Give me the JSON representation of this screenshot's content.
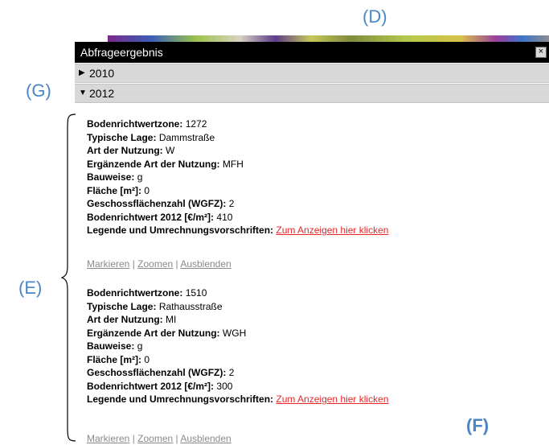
{
  "annotations": {
    "d": "(D)",
    "g": "(G)",
    "e": "(E)",
    "f": "(F)"
  },
  "window": {
    "title": "Abfrageergebnis",
    "close_label": "×"
  },
  "years": [
    {
      "label": "2010",
      "expanded": false
    },
    {
      "label": "2012",
      "expanded": true
    }
  ],
  "records": [
    {
      "fields": [
        {
          "key": "Bodenrichtwertzone:",
          "value": "1272"
        },
        {
          "key": "Typische Lage:",
          "value": "Dammstraße"
        },
        {
          "key": "Art der Nutzung:",
          "value": "W"
        },
        {
          "key": "Ergänzende Art der Nutzung:",
          "value": "MFH"
        },
        {
          "key": "Bauweise:",
          "value": "g"
        },
        {
          "key": "Fläche [m²]:",
          "value": "0"
        },
        {
          "key": "Geschossflächenzahl (WGFZ):",
          "value": "2"
        },
        {
          "key": "Bodenrichtwert 2012 [€/m²]:",
          "value": "410"
        }
      ],
      "legend_key": "Legende und Umrechnungsvorschriften:",
      "legend_link": "Zum Anzeigen hier klicken",
      "actions": [
        "Markieren",
        "Zoomen",
        "Ausblenden"
      ]
    },
    {
      "fields": [
        {
          "key": "Bodenrichtwertzone:",
          "value": "1510"
        },
        {
          "key": "Typische Lage:",
          "value": "Rathausstraße"
        },
        {
          "key": "Art der Nutzung:",
          "value": "MI"
        },
        {
          "key": "Ergänzende Art der Nutzung:",
          "value": "WGH"
        },
        {
          "key": "Bauweise:",
          "value": "g"
        },
        {
          "key": "Fläche [m²]:",
          "value": "0"
        },
        {
          "key": "Geschossflächenzahl (WGFZ):",
          "value": "2"
        },
        {
          "key": "Bodenrichtwert 2012 [€/m²]:",
          "value": "300"
        }
      ],
      "legend_key": "Legende und Umrechnungsvorschriften:",
      "legend_link": "Zum Anzeigen hier klicken",
      "actions": [
        "Markieren",
        "Zoomen",
        "Ausblenden"
      ]
    }
  ],
  "colors": {
    "annotation": "#4a86c5",
    "link": "#e8262a",
    "titlebar": "#000000",
    "yearbar": "#d8d8d8"
  }
}
